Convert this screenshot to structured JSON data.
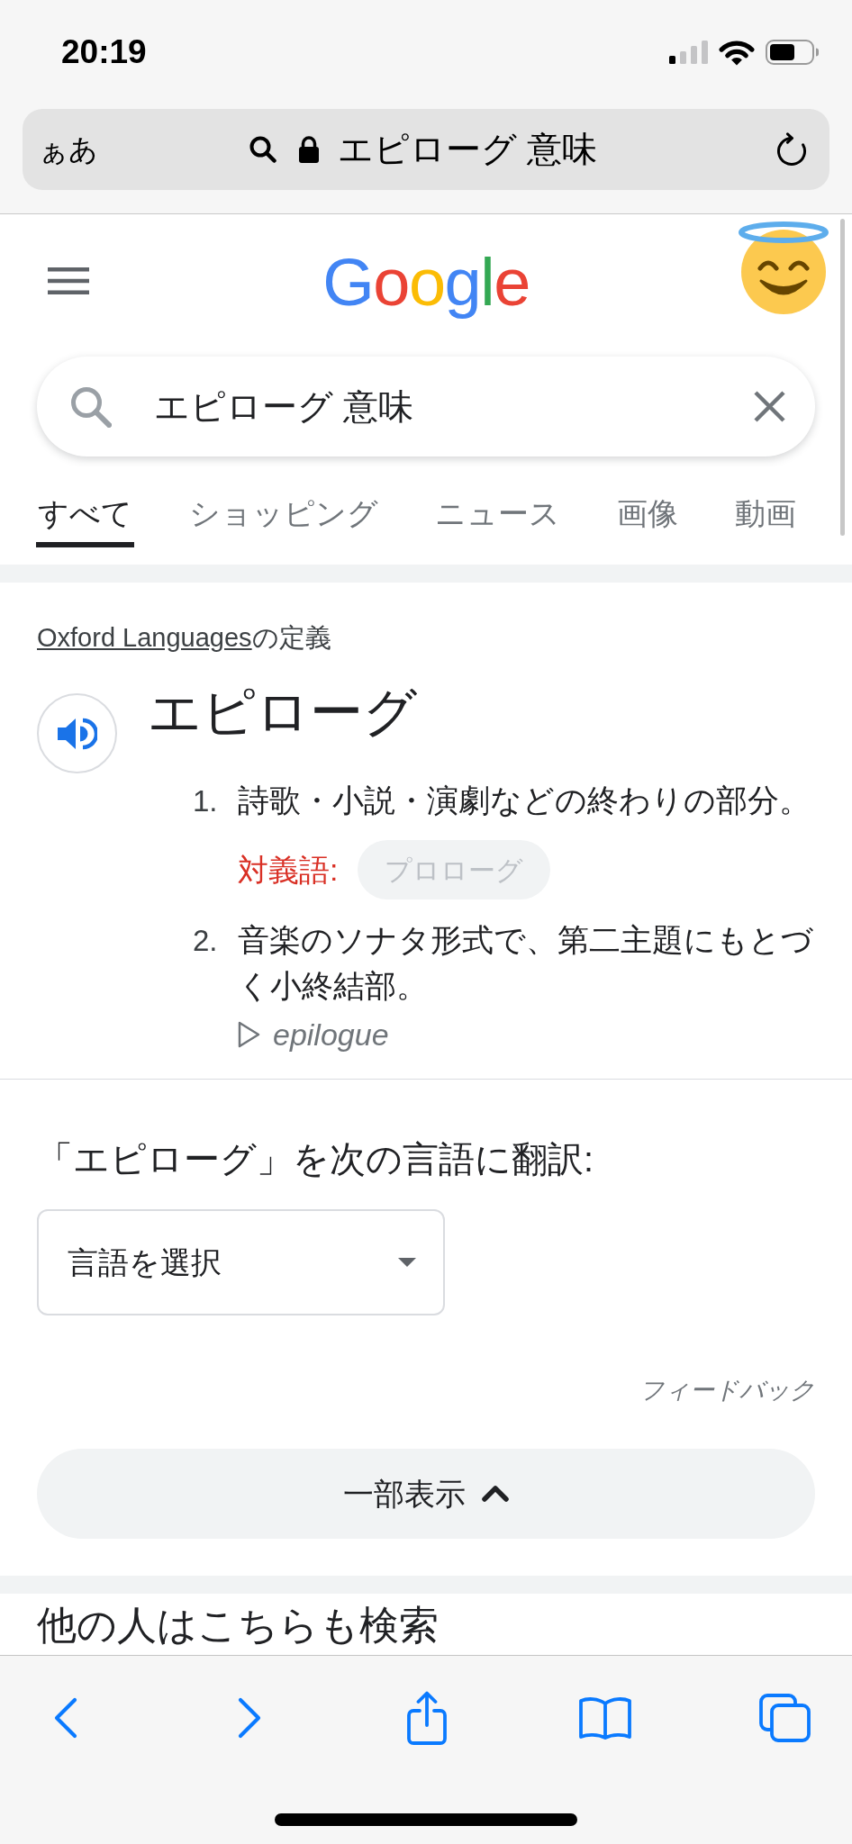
{
  "status_bar": {
    "time": "20:19"
  },
  "address_bar": {
    "text_size_label": "ぁあ",
    "query": "エピローグ 意味"
  },
  "header": {
    "logo": "Google"
  },
  "search": {
    "value": "エピローグ 意味"
  },
  "tabs": [
    {
      "label": "すべて",
      "selected": true
    },
    {
      "label": "ショッピング",
      "selected": false
    },
    {
      "label": "ニュース",
      "selected": false
    },
    {
      "label": "画像",
      "selected": false
    },
    {
      "label": "動画",
      "selected": false
    }
  ],
  "dictionary": {
    "source_link": "Oxford Languages",
    "source_suffix": "の定義",
    "headword": "エピローグ",
    "senses": [
      {
        "number": "1.",
        "text": "詩歌・小説・演劇などの終わりの部分。",
        "antonym_label": "対義語:",
        "antonyms": [
          "プロローグ"
        ]
      },
      {
        "number": "2.",
        "text": "音楽のソナタ形式で、第二主題にもとづく小終結部。",
        "origin": "epilogue"
      }
    ]
  },
  "translate": {
    "title": "「エピローグ」を次の言語に翻訳:",
    "language_select": "言語を選択",
    "feedback": "フィードバック",
    "collapse_button": "一部表示"
  },
  "related": {
    "heading": "他の人はこちらも検索"
  }
}
